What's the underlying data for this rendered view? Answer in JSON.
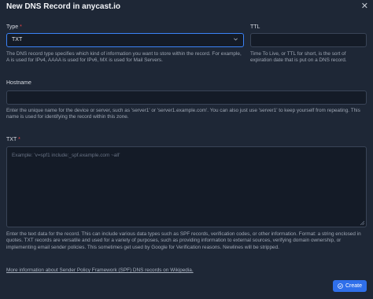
{
  "dialog": {
    "title": "New DNS Record in anycast.io",
    "close_icon": "close-icon"
  },
  "type": {
    "label": "Type",
    "required_mark": "*",
    "selected": "TXT",
    "help": "The DNS record type specifies which kind of information you want to store within the record. For example, A is used for IPv4, AAAA is used for IPv6, MX is used for Mail Servers."
  },
  "ttl": {
    "label": "TTL",
    "value": "",
    "help": "Time To Live, or TTL for short, is the sort of expiration date that is put on a DNS record."
  },
  "hostname": {
    "label": "Hostname",
    "value": "",
    "help": "Enter the unique name for the device or server, such as 'server1' or 'server1.example.com'. You can also just use 'server1' to keep yourself from repeating. This name is used for identifying the record within this zone."
  },
  "txt": {
    "label": "TXT",
    "required_mark": "*",
    "placeholder": "Example: 'v=spf1 include:_spf.example.com ~all'",
    "help": "Enter the text data for the record. This can include various data types such as SPF records, verification codes, or other information. Format: a string enclosed in quotes. TXT records are versatile and used for a variety of purposes, such as providing information to external sources, verifying domain ownership, or implementing email sender policies. This sometimes get used by Google for Verification reasons. Newlines will be stripped."
  },
  "more_info_link": "More information about Sender Policy Framework (SPF) DNS records on Wikipedia.",
  "create_button": {
    "label": "Create",
    "icon": "check-circle-icon",
    "color": "#2f6fea"
  },
  "colors": {
    "background": "#1e2736",
    "focus": "#3b82f6",
    "required": "#ef4444"
  }
}
